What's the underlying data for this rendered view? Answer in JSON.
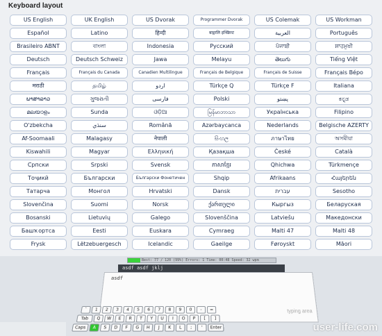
{
  "title": "Keyboard layout",
  "layouts": [
    "US English",
    "UK English",
    "US Dvorak",
    "Programmer Dvorak",
    "US Colemak",
    "US Workman",
    "Español",
    "Latino",
    "हिन्दी",
    "बाङ्गालि इन्स्क्रिप्ट",
    "العربية",
    "Português",
    "Brasileiro ABNT",
    "বাংলা",
    "Indonesia",
    "Русский",
    "ਪੰਜਾਬੀ",
    "ਸ਼ਾਹਮੁਖੀ",
    "Deutsch",
    "Deutsch Schweiz",
    "Jawa",
    "Melayu",
    "తెలుగు",
    "Tiếng Việt",
    "Français",
    "Français du Canada",
    "Canadien Multilingue",
    "Français de Belgique",
    "Français de Suisse",
    "Français Bépo",
    "मराठी",
    "தமிழ்",
    "اردو",
    "Türkçe Q",
    "Türkçe F",
    "Italiana",
    "ພາສາລາວ",
    "ગુજરાતી",
    "فارسی",
    "Polski",
    "پښتو",
    "ಕನ್ನಡ",
    "മലയാളം",
    "Sunda",
    "ଓଡ଼ିଆ",
    "မြန်မာဘာသာ",
    "Українська",
    "Filipino",
    "O'zbekcha",
    "سنڌي",
    "Română",
    "Azərbaycanca",
    "Nederlands",
    "Belgische AZERTY",
    "Af-Soomaali",
    "Malagasy",
    "नेपाली",
    "සිංහල",
    "ภาษาไทย",
    "অসমীয়া",
    "Kiswahili",
    "Magyar",
    "Ελληνική",
    "Қазақша",
    "České",
    "Català",
    "Српски",
    "Srpski",
    "Svensk",
    "ភាសាខ្មែរ",
    "Qhichwa",
    "Türkmençe",
    "Тоҷикӣ",
    "Български",
    "Български Фонетичен",
    "Shqip",
    "Afrikaans",
    "Հայերեն",
    "Татарча",
    "Монгол",
    "Hrvatski",
    "Dansk",
    "עברית",
    "Sesotho",
    "Slovenčina",
    "Suomi",
    "Norsk",
    "ქართული",
    "Кыргыз",
    "Беларуская",
    "Bosanski",
    "Lietuvių",
    "Galego",
    "Slovenščina",
    "Latviešu",
    "Македонски",
    "Башҡортса",
    "Eesti",
    "Euskara",
    "Cymraeg",
    "Malti 47",
    "Malti 48",
    "Frysk",
    "Lëtzebuergesch",
    "Icelandic",
    "Gaeilge",
    "Føroyskt",
    "Māori"
  ],
  "preview": {
    "status_text": "Best: 77 / 120 (99%) Errors: 1  Time: 00:48  Speed: 32 wpm",
    "typed_line": "asdf asdf jklj",
    "paper_text": "asdf",
    "typing_hint": "typing area",
    "keys_row1": [
      "`",
      "1",
      "2",
      "3",
      "4",
      "5",
      "6",
      "7",
      "8",
      "9",
      "0",
      "-",
      "="
    ],
    "keys_row2": [
      "Tab",
      "Q",
      "W",
      "E",
      "R",
      "T",
      "Y",
      "U",
      "I",
      "O",
      "P",
      "[",
      "]"
    ],
    "keys_row3": [
      "Caps",
      "A",
      "S",
      "D",
      "F",
      "G",
      "H",
      "J",
      "K",
      "L",
      ";",
      "'",
      "Enter"
    ],
    "watermark": "user-life.com"
  },
  "colors": {
    "button_border": "#b9c6da",
    "button_text": "#1a2a4a",
    "highlight_key": "#2fc62f"
  }
}
